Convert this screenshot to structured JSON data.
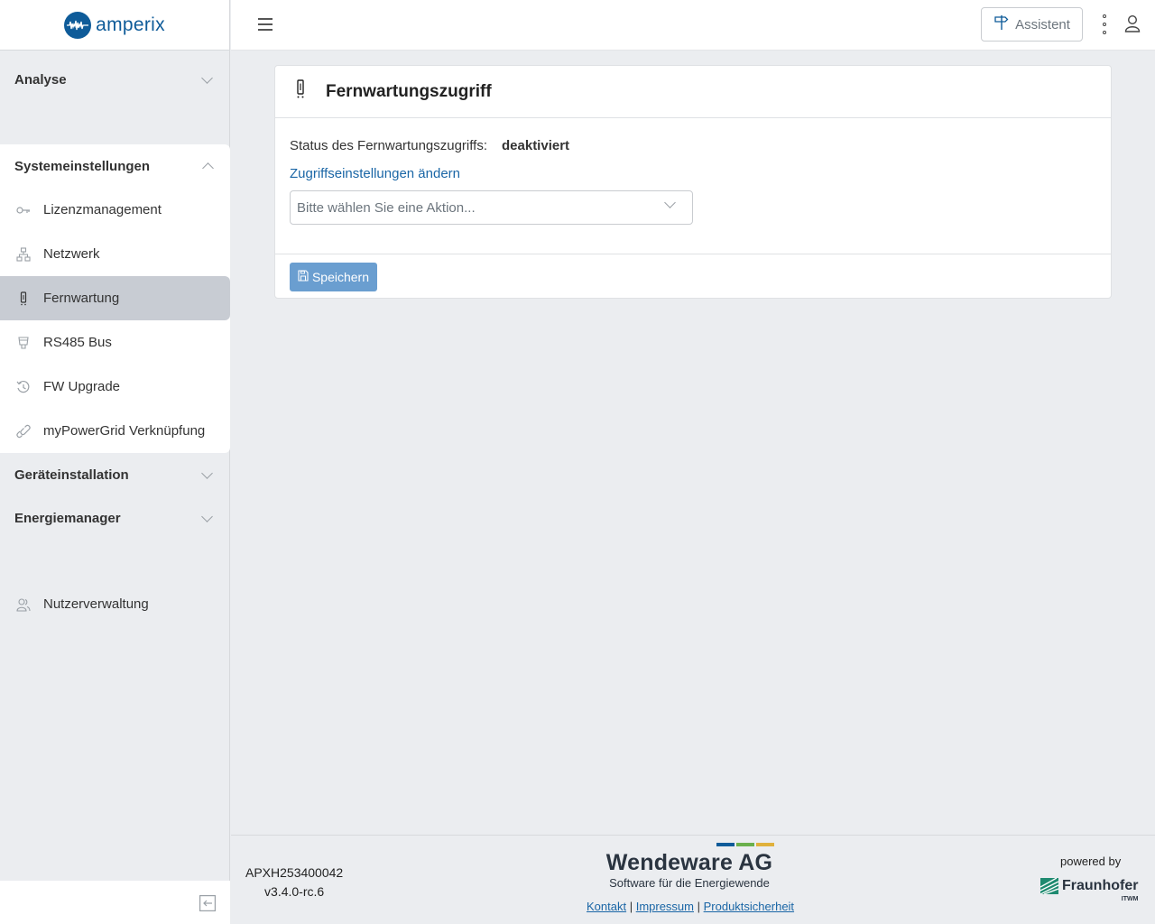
{
  "app": {
    "logo_text": "amperix",
    "brand_color": "#0e5b99"
  },
  "sidebar": {
    "sections": {
      "analyse": "Analyse",
      "system": "Systemeinstellungen",
      "install": "Geräteinstallation",
      "energy": "Energiemanager"
    },
    "items": [
      {
        "label": "Lizenzmanagement",
        "icon": "key-icon"
      },
      {
        "label": "Netzwerk",
        "icon": "network-icon"
      },
      {
        "label": "Fernwartung",
        "icon": "remote-icon",
        "active": true
      },
      {
        "label": "RS485 Bus",
        "icon": "plug-icon"
      },
      {
        "label": "FW Upgrade",
        "icon": "history-icon"
      },
      {
        "label": "myPowerGrid Verknüpfung",
        "icon": "link-icon"
      }
    ],
    "user_mgmt": "Nutzerverwaltung"
  },
  "topbar": {
    "assistant_label": "Assistent"
  },
  "card": {
    "title": "Fernwartungszugriff",
    "status_label": "Status des Fernwartungszugriffs:",
    "status_value": "deaktiviert",
    "link_label": "Zugriffseinstellungen ändern",
    "select_placeholder": "Bitte wählen Sie eine Aktion...",
    "save_label": "Speichern"
  },
  "footer": {
    "serial": "APXH253400042",
    "version": "v3.4.0-rc.6",
    "brand_name": "Wendeware AG",
    "brand_sub": "Software für die Energiewende",
    "links": [
      "Kontakt",
      "Impressum",
      "Produktsicherheit"
    ],
    "powered_by": "powered by",
    "partner": "Fraunhofer",
    "partner_sub": "ITWM"
  }
}
